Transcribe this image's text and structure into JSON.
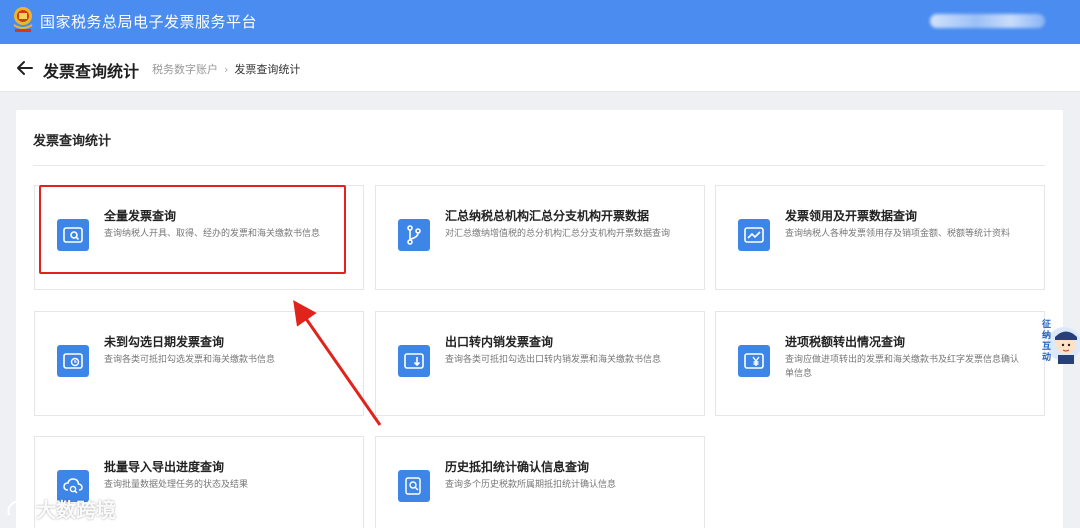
{
  "app": {
    "title": "国家税务总局电子发票服务平台",
    "emblem_icon": "tax-bureau-emblem-icon",
    "brand_color": "#4a8cf0"
  },
  "header": {
    "title": "发票查询统计",
    "back_icon": "arrow-left-icon",
    "breadcrumb": [
      {
        "label": "税务数字账户"
      },
      {
        "label": "发票查询统计"
      }
    ]
  },
  "section": {
    "title": "发票查询统计"
  },
  "cards": [
    {
      "title": "全量发票查询",
      "desc": "查询纳税人开具、取得、经办的发票和海关缴款书信息",
      "icon": "invoice-search-icon"
    },
    {
      "title": "汇总纳税总机构汇总分支机构开票数据",
      "desc": "对汇总缴纳增值税的总分机构汇总分支机构开票数据查询",
      "icon": "branch-icon"
    },
    {
      "title": "发票领用及开票数据查询",
      "desc": "查询纳税人各种发票领用存及销项金额、税额等统计资料",
      "icon": "trend-ticket-icon"
    },
    {
      "title": "未到勾选日期发票查询",
      "desc": "查询各类可抵扣勾选发票和海关缴款书信息",
      "icon": "clock-ticket-icon"
    },
    {
      "title": "出口转内销发票查询",
      "desc": "查询各类可抵扣勾选出口转内销发票和海关缴款书信息",
      "icon": "ticket-arrow-icon"
    },
    {
      "title": "进项税额转出情况查询",
      "desc": "查询应做进项转出的发票和海关缴款书及红字发票信息确认单信息",
      "icon": "yen-transfer-icon"
    },
    {
      "title": "批量导入导出进度查询",
      "desc": "查询批量数据处理任务的状态及结果",
      "icon": "cloud-search-icon"
    },
    {
      "title": "历史抵扣统计确认信息查询",
      "desc": "查询多个历史税款所属期抵扣统计确认信息",
      "icon": "history-search-icon"
    }
  ],
  "helper": {
    "label": "征纳互动"
  },
  "watermark": {
    "text": "大数跨境"
  },
  "annotation_color": "#e0241b"
}
